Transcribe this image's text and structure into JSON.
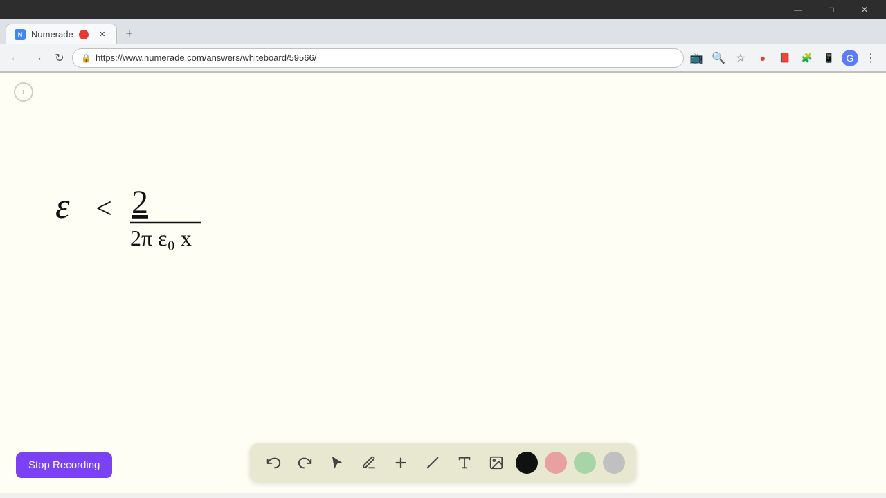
{
  "browser": {
    "title": "Numerade",
    "url": "https://www.numerade.com/answers/whiteboard/59566/",
    "tab_label": "Numerade",
    "new_tab_icon": "+",
    "favicon_text": "N"
  },
  "nav": {
    "back_icon": "←",
    "forward_icon": "→",
    "refresh_icon": "↻",
    "home_icon": "⌂"
  },
  "window_controls": {
    "minimize": "—",
    "maximize": "□",
    "close": "✕"
  },
  "toolbar": {
    "undo_icon": "↩",
    "redo_icon": "↪",
    "select_icon": "▶",
    "pen_icon": "✏",
    "add_icon": "+",
    "line_icon": "/",
    "text_icon": "A",
    "image_icon": "🖼",
    "colors": [
      "#111111",
      "#e8a0a0",
      "#a8d5a8",
      "#c0c0c0"
    ]
  },
  "stop_recording": {
    "label": "Stop Recording"
  },
  "whiteboard": {
    "background": "#fefef5",
    "indicator_label": "i"
  }
}
